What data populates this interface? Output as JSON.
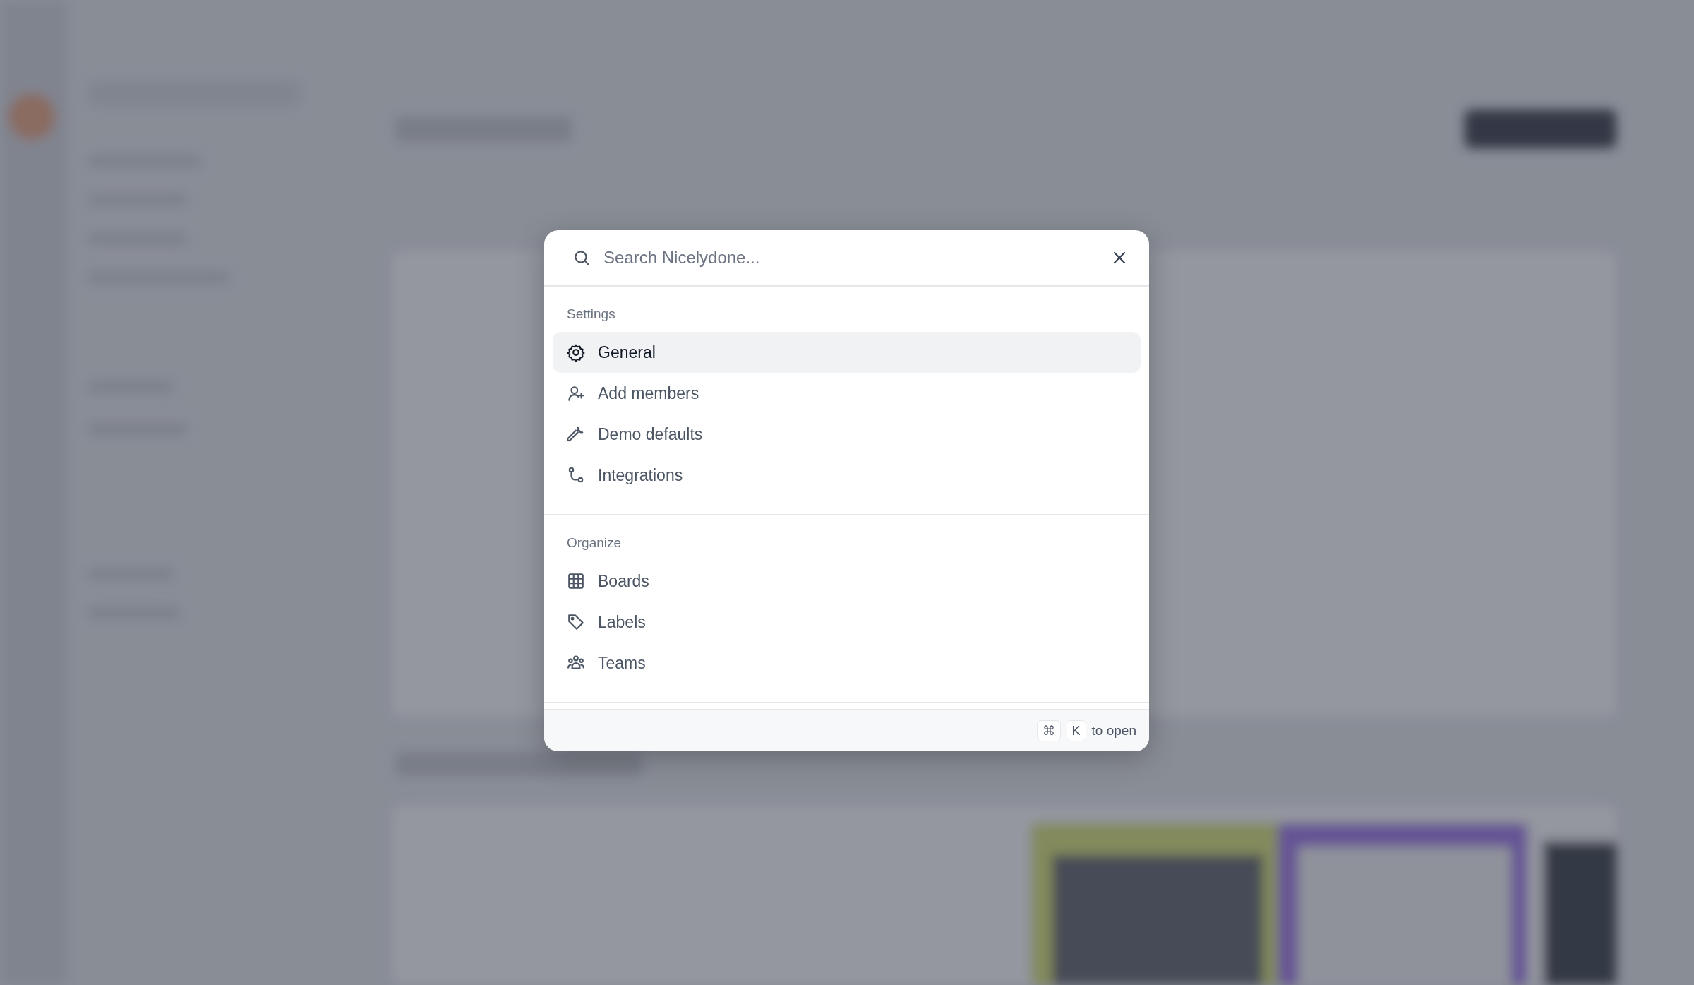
{
  "search": {
    "placeholder": "Search Nicelydone..."
  },
  "groups": [
    {
      "title": "Settings",
      "items": [
        {
          "label": "General",
          "kind": "gear",
          "selected": true
        },
        {
          "label": "Add members",
          "kind": "user-plus",
          "selected": false
        },
        {
          "label": "Demo defaults",
          "kind": "wrench",
          "selected": false
        },
        {
          "label": "Integrations",
          "kind": "branch",
          "selected": false
        }
      ]
    },
    {
      "title": "Organize",
      "items": [
        {
          "label": "Boards",
          "kind": "grid",
          "selected": false
        },
        {
          "label": "Labels",
          "kind": "tag",
          "selected": false
        },
        {
          "label": "Teams",
          "kind": "users",
          "selected": false
        }
      ]
    }
  ],
  "footer": {
    "keys": [
      "⌘",
      "K"
    ],
    "hint": "to open"
  }
}
